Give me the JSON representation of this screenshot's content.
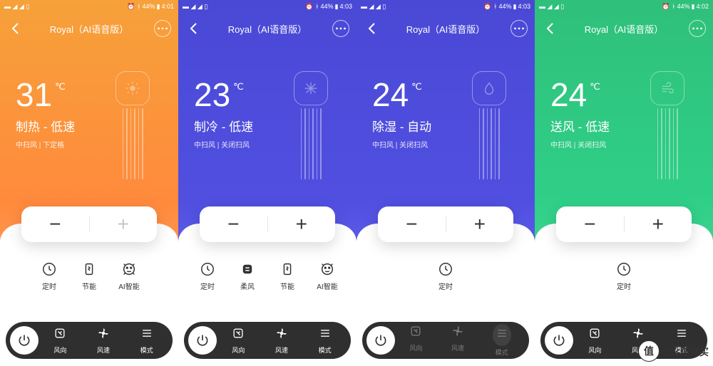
{
  "watermark": "什么值得买",
  "watermark_badge": "值",
  "screens": [
    {
      "status_time": "4:01",
      "status_battery": "44%",
      "title": "Royal（AI语音版）",
      "temp": "31",
      "unit": "℃",
      "mode_line": "制热 - 低速",
      "sub_line": "中扫风 | 下定格",
      "features": [
        {
          "icon": "clock",
          "label": "定时"
        },
        {
          "icon": "eco",
          "label": "节能"
        },
        {
          "icon": "ai",
          "label": "AI智能"
        }
      ],
      "bottom": [
        {
          "icon": "swing",
          "label": "风向",
          "dim": false
        },
        {
          "icon": "fan",
          "label": "风速",
          "dim": false
        },
        {
          "icon": "menu",
          "label": "模式",
          "dim": false
        }
      ],
      "tower_icon": "sun"
    },
    {
      "status_time": "4:03",
      "status_battery": "44%",
      "title": "Royal（AI语音版）",
      "temp": "23",
      "unit": "℃",
      "mode_line": "制冷 - 低速",
      "sub_line": "中扫风 | 关闭扫风",
      "features": [
        {
          "icon": "clock",
          "label": "定时"
        },
        {
          "icon": "soft",
          "label": "柔风"
        },
        {
          "icon": "eco",
          "label": "节能"
        },
        {
          "icon": "ai",
          "label": "AI智能"
        }
      ],
      "bottom": [
        {
          "icon": "swing",
          "label": "风向",
          "dim": false
        },
        {
          "icon": "fan",
          "label": "风速",
          "dim": false
        },
        {
          "icon": "menu",
          "label": "模式",
          "dim": false
        }
      ],
      "tower_icon": "snow"
    },
    {
      "status_time": "4:03",
      "status_battery": "44%",
      "title": "Royal（AI语音版）",
      "temp": "24",
      "unit": "℃",
      "mode_line": "除湿 - 自动",
      "sub_line": "中扫风 | 关闭扫风",
      "features": [
        {
          "icon": "clock",
          "label": "定时"
        }
      ],
      "bottom": [
        {
          "icon": "swing",
          "label": "风向",
          "dim": true
        },
        {
          "icon": "fan",
          "label": "风速",
          "dim": true
        },
        {
          "icon": "menu",
          "label": "模式",
          "dim": true
        }
      ],
      "tower_icon": "drop"
    },
    {
      "status_time": "4:02",
      "status_battery": "44%",
      "title": "Royal（AI语音版）",
      "temp": "24",
      "unit": "℃",
      "mode_line": "送风 - 低速",
      "sub_line": "中扫风 | 关闭扫风",
      "features": [
        {
          "icon": "clock",
          "label": "定时"
        }
      ],
      "bottom": [
        {
          "icon": "swing",
          "label": "风向",
          "dim": false
        },
        {
          "icon": "fan",
          "label": "风速",
          "dim": false
        },
        {
          "icon": "menu",
          "label": "模式",
          "dim": false
        }
      ],
      "tower_icon": "wind"
    }
  ]
}
